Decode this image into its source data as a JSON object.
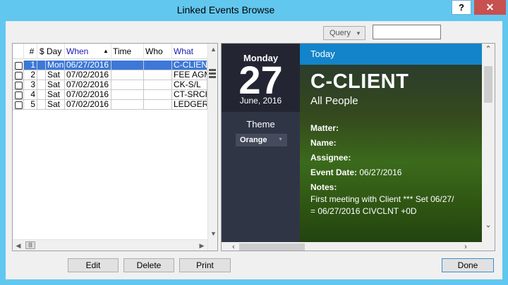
{
  "window": {
    "title": "Linked Events Browse",
    "help_label": "?",
    "close_label": "✕"
  },
  "toolbar": {
    "query_label": "Query",
    "query_input_value": ""
  },
  "grid": {
    "columns": [
      "#",
      "$",
      "Day",
      "When",
      "Time",
      "Who",
      "What"
    ],
    "rows": [
      {
        "num": "1",
        "dollar": "",
        "day": "Mon",
        "when": "06/27/2016",
        "time": "",
        "who": "",
        "what": "C-CLIENT",
        "selected": true
      },
      {
        "num": "2",
        "dollar": "",
        "day": "Sat",
        "when": "07/02/2016",
        "time": "",
        "who": "",
        "what": "FEE AGM",
        "selected": false
      },
      {
        "num": "3",
        "dollar": "",
        "day": "Sat",
        "when": "07/02/2016",
        "time": "",
        "who": "",
        "what": "CK-S/L",
        "selected": false
      },
      {
        "num": "4",
        "dollar": "",
        "day": "Sat",
        "when": "07/02/2016",
        "time": "",
        "who": "",
        "what": "CT-SRCH",
        "selected": false
      },
      {
        "num": "5",
        "dollar": "",
        "day": "Sat",
        "when": "07/02/2016",
        "time": "",
        "who": "",
        "what": "LEDGER",
        "selected": false
      }
    ]
  },
  "preview": {
    "weekday": "Monday",
    "day": "27",
    "month_year": "June, 2016",
    "theme_label": "Theme",
    "theme_value": "Orange",
    "header": "Today",
    "event_title": "C-CLIENT",
    "event_subtitle": "All People",
    "matter_label": "Matter:",
    "name_label": "Name:",
    "assignee_label": "Assignee:",
    "event_date_label": "Event Date:",
    "event_date_value": "06/27/2016",
    "notes_label": "Notes:",
    "notes_line1": "First meeting with Client *** Set 06/27/",
    "notes_line2": "= 06/27/2016 CIVCLNT +0D"
  },
  "buttons": {
    "edit": "Edit",
    "delete": "Delete",
    "print": "Print",
    "done": "Done"
  },
  "colors": {
    "titlebar": "#62c7ef",
    "selection": "#3d78d8",
    "today_bar": "#1384c9",
    "close": "#c75050"
  }
}
